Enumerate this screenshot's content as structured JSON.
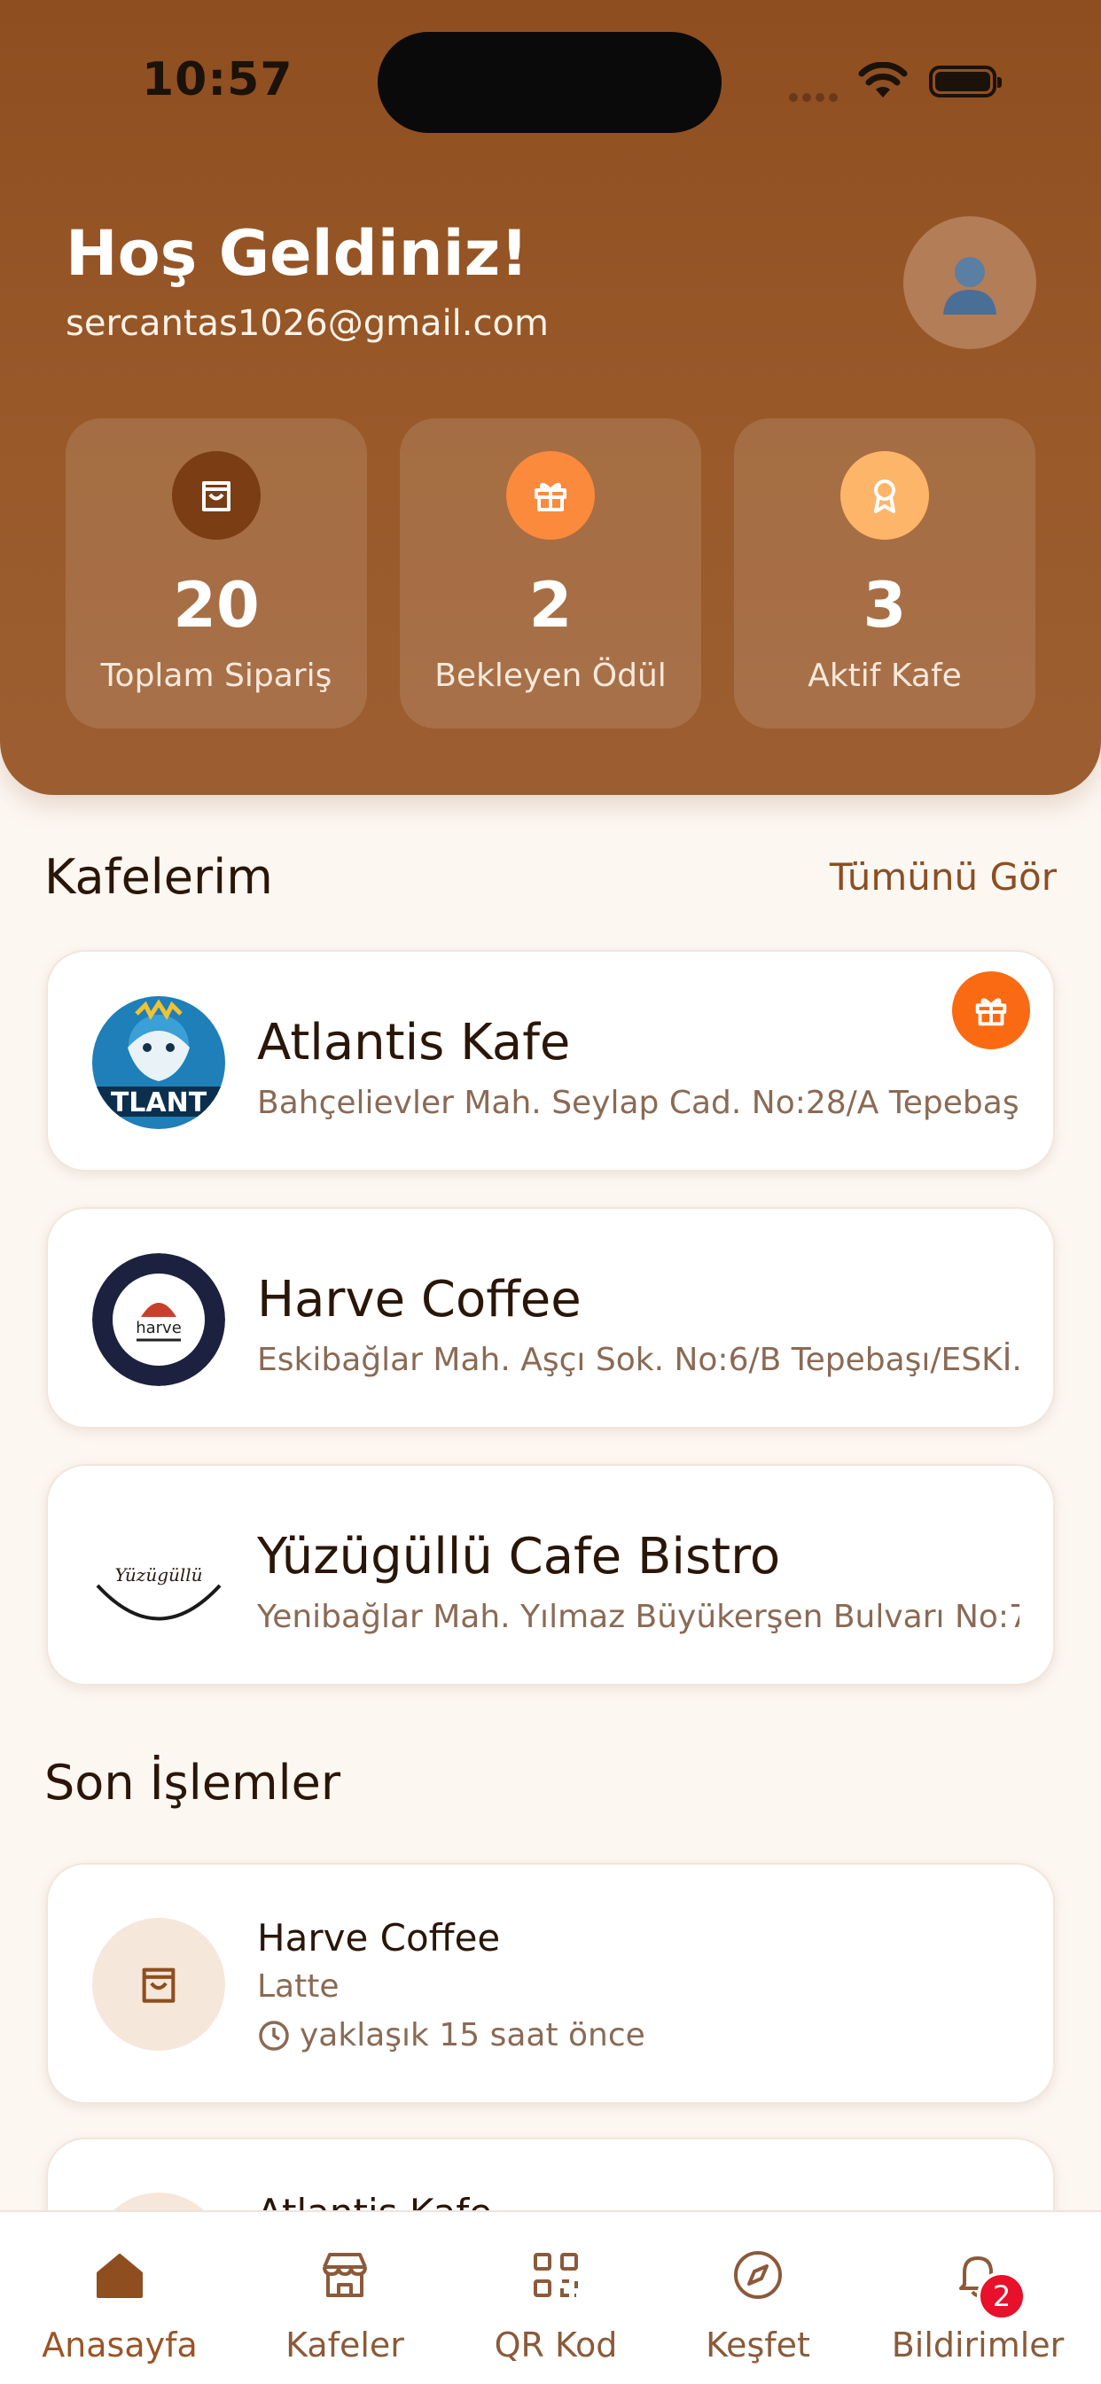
{
  "status_bar": {
    "time": "10:57"
  },
  "header": {
    "welcome": "Hoş Geldiniz!",
    "email": "sercantas1026@gmail.com",
    "avatar_icon": "user-avatar-icon"
  },
  "stats": [
    {
      "value": "20",
      "label": "Toplam Sipariş",
      "icon": "shopping-bag-icon",
      "color": "#8e4e1f"
    },
    {
      "value": "2",
      "label": "Bekleyen Ödül",
      "icon": "gift-icon",
      "color": "#fb8a3c"
    },
    {
      "value": "3",
      "label": "Aktif Kafe",
      "icon": "award-icon",
      "color": "#fdb56a"
    }
  ],
  "cafes_section": {
    "title": "Kafelerim",
    "see_all": "Tümünü Gör",
    "items": [
      {
        "name": "Atlantis Kafe",
        "address": "Bahçelievler Mah. Seylap Cad. No:28/A Tepebaşı...",
        "logo_text": "TLANT",
        "has_reward": true
      },
      {
        "name": "Harve Coffee",
        "address": "Eskibağlar Mah. Aşçı Sok. No:6/B Tepebaşı/ESKİ...",
        "logo_text": "harve"
      },
      {
        "name": "Yüzügüllü Cafe Bistro",
        "address": "Yenibağlar Mah. Yılmaz Büyükerşen Bulvarı No:7...",
        "logo_text": "Yüzügüllü"
      }
    ]
  },
  "transactions_section": {
    "title": "Son İşlemler",
    "items": [
      {
        "cafe": "Harve Coffee",
        "item": "Latte",
        "time": "yaklaşık 15 saat önce"
      },
      {
        "cafe": "Atlantis Kafe"
      }
    ]
  },
  "tabbar": {
    "items": [
      {
        "label": "Anasayfa",
        "icon": "home-icon",
        "active": true
      },
      {
        "label": "Kafeler",
        "icon": "store-icon"
      },
      {
        "label": "QR Kod",
        "icon": "qr-code-icon"
      },
      {
        "label": "Keşfet",
        "icon": "compass-icon"
      },
      {
        "label": "Bildirimler",
        "icon": "bell-icon",
        "badge": "2"
      }
    ]
  },
  "colors": {
    "brand": "#8e4e1f",
    "accent": "#fa6a12",
    "background": "#fdf7f2"
  }
}
